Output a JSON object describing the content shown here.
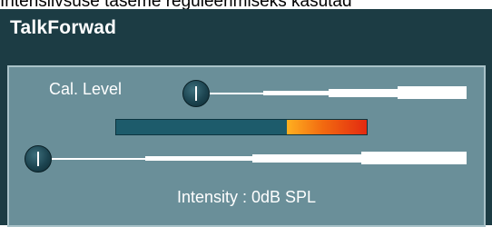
{
  "top_text": "Intensiivsuse taseme reguleerimiseks kasutad",
  "panel": {
    "title": "TalkForwad",
    "cal_level_label": "Cal. Level",
    "intensity_text": "Intensity : 0dB SPL"
  },
  "meter": {
    "level_fraction": 1.0,
    "hot_start_fraction": 0.68,
    "colors": {
      "base": "#1d5b6b",
      "hot_start": "#ffb020",
      "hot_end": "#e32a10"
    }
  },
  "sliders": {
    "cal_level": {
      "value_fraction": 0.0
    },
    "intensity": {
      "value_fraction": 0.0
    }
  },
  "colors": {
    "panel_bg": "#1c3c44",
    "inner_bg": "#6a8f99",
    "inner_border": "#a9c2c8",
    "text": "#ffffff"
  }
}
